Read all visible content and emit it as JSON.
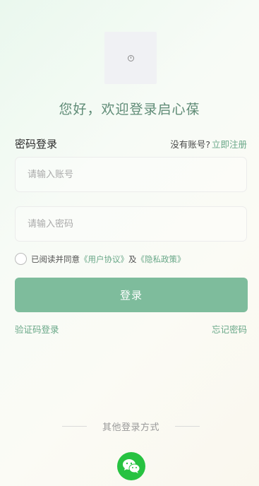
{
  "welcome_title": "您好，欢迎登录启心葆",
  "login_section": {
    "title": "密码登录",
    "no_account_text": "没有账号?",
    "register_link": "立即注册"
  },
  "account_field": {
    "placeholder": "请输入账号",
    "value": ""
  },
  "password_field": {
    "placeholder": "请输入密码",
    "value": ""
  },
  "agreement": {
    "prefix": "已阅读并同意",
    "user_agreement": "《用户协议》",
    "conjunction": "及",
    "privacy_policy": "《隐私政策》",
    "checked": false
  },
  "login_button": "登录",
  "sms_login_link": "验证码登录",
  "forgot_password_link": "忘记密码",
  "other_login": {
    "label": "其他登录方式",
    "icons": [
      "wechat-icon"
    ]
  },
  "colors": {
    "accent": "#7ebc9c",
    "link": "#6aa889",
    "title": "#5f8b76",
    "wechat": "#27c241"
  },
  "icons": {
    "logo": "logo-placeholder-icon"
  }
}
